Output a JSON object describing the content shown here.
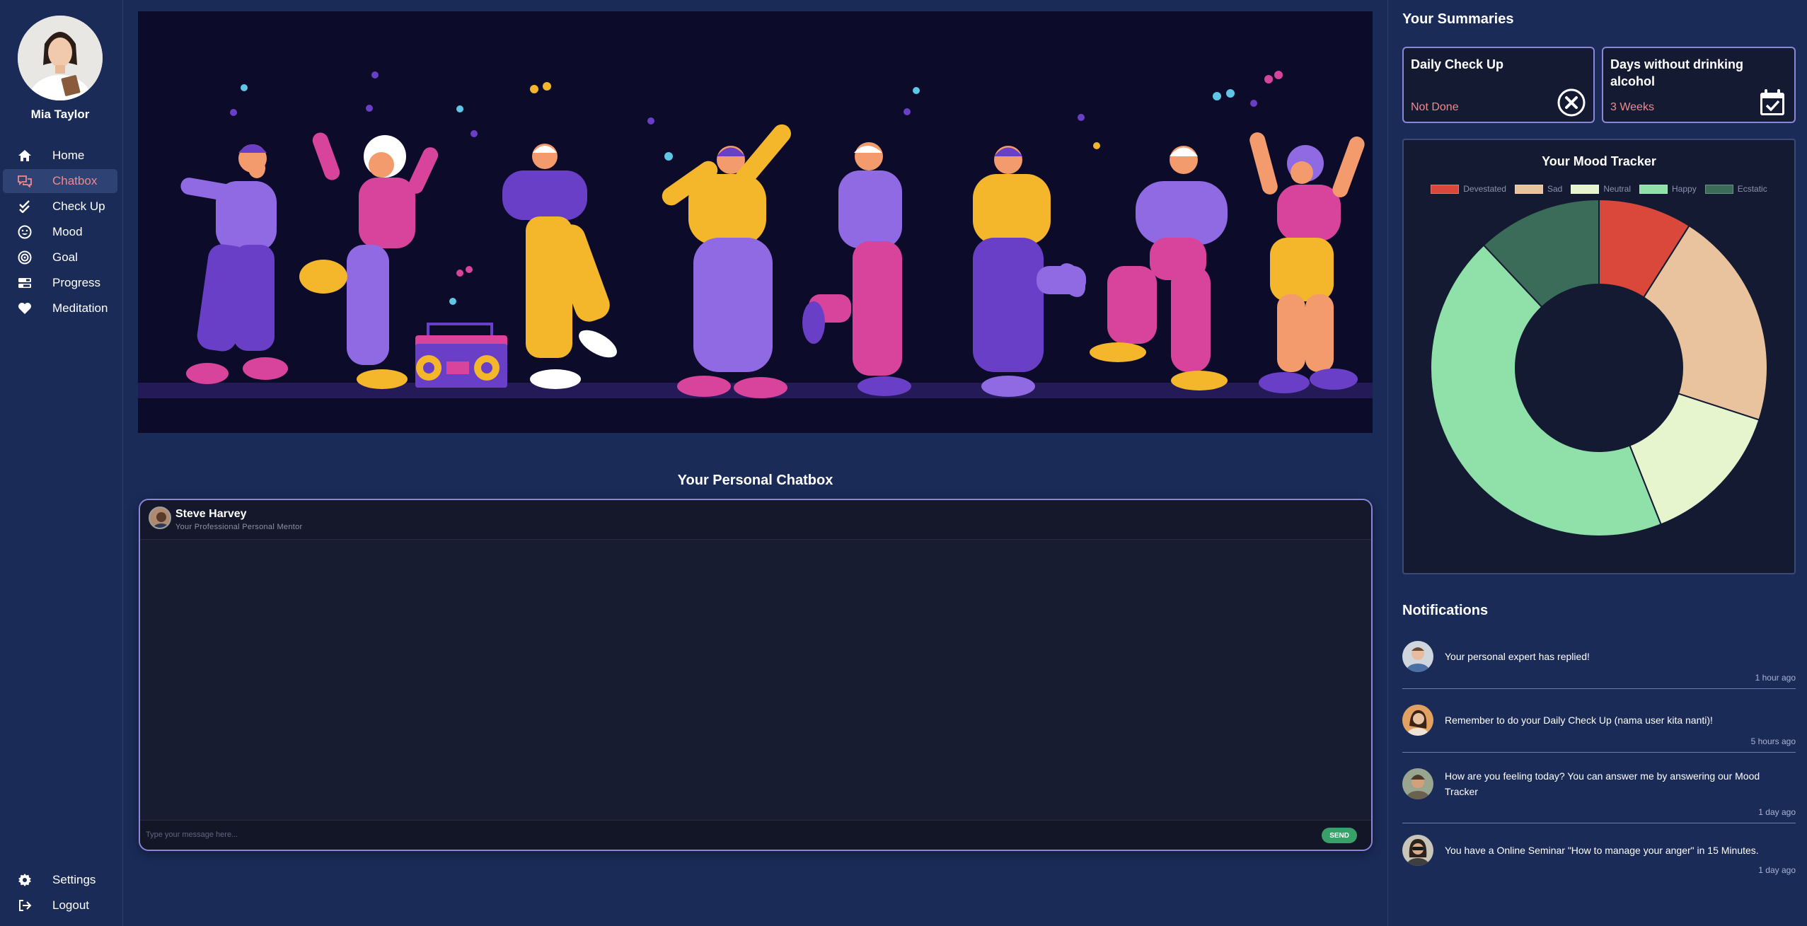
{
  "user": {
    "name": "Mia Taylor"
  },
  "nav": {
    "items": [
      {
        "label": "Home",
        "icon": "home-icon",
        "active": false
      },
      {
        "label": "Chatbox",
        "icon": "chat-icon",
        "active": true
      },
      {
        "label": "Check Up",
        "icon": "double-check-icon",
        "active": false
      },
      {
        "label": "Mood",
        "icon": "smiley-icon",
        "active": false
      },
      {
        "label": "Goal",
        "icon": "target-icon",
        "active": false
      },
      {
        "label": "Progress",
        "icon": "progress-bars-icon",
        "active": false
      },
      {
        "label": "Meditation",
        "icon": "heart-icon",
        "active": false
      }
    ],
    "bottom": [
      {
        "label": "Settings",
        "icon": "gear-icon"
      },
      {
        "label": "Logout",
        "icon": "logout-icon"
      }
    ]
  },
  "chat": {
    "title": "Your Personal Chatbox",
    "mentor_name": "Steve Harvey",
    "mentor_role": "Your Professional Personal Mentor",
    "input_placeholder": "Type your message here...",
    "send_label": "SEND"
  },
  "summaries": {
    "title": "Your Summaries",
    "cards": [
      {
        "title": "Daily Check Up",
        "status": "Not Done",
        "icon": "close-circle-icon"
      },
      {
        "title": "Days without drinking alcohol",
        "status": "3 Weeks",
        "icon": "calendar-check-icon"
      }
    ]
  },
  "mood": {
    "title": "Your Mood Tracker"
  },
  "chart_data": {
    "type": "pie",
    "title": "Your Mood Tracker",
    "variant": "doughnut",
    "legend_position": "top",
    "categories": [
      "Devestated",
      "Sad",
      "Neutral",
      "Happy",
      "Ecstatic"
    ],
    "values": [
      9,
      21,
      14,
      44,
      12
    ],
    "colors": [
      "#d9483b",
      "#e8c39e",
      "#e7f5cf",
      "#8fe0a9",
      "#3b6b59"
    ]
  },
  "notifications": {
    "title": "Notifications",
    "items": [
      {
        "text": "Your personal expert has replied!",
        "time": "1 hour ago"
      },
      {
        "text": "Remember to do your Daily Check Up (nama user kita nanti)!",
        "time": "5 hours ago"
      },
      {
        "text": "How are you feeling today? You can answer me by answering our Mood Tracker",
        "time": "1 day ago"
      },
      {
        "text": "You have a Online Seminar \"How to manage your anger\" in 15 Minutes.",
        "time": "1 day ago"
      }
    ]
  }
}
